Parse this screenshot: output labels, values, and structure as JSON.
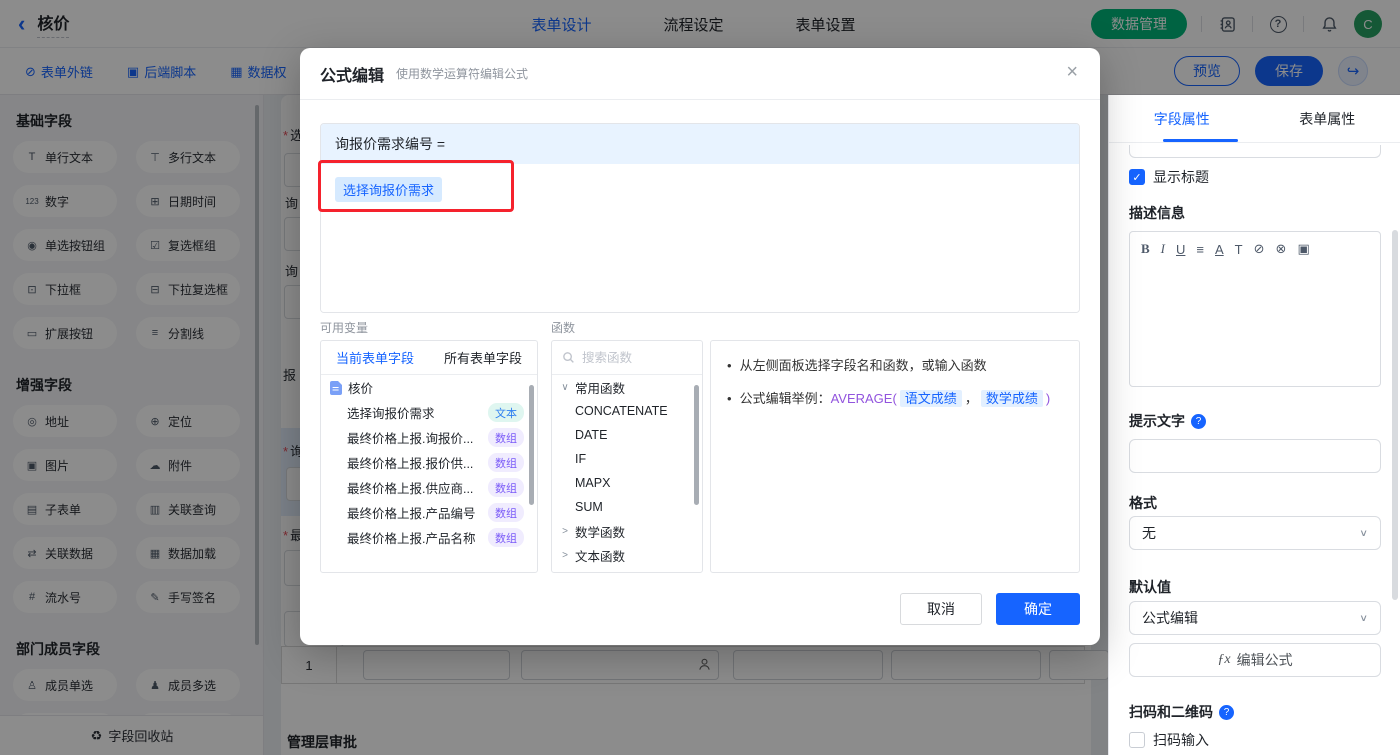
{
  "misc": {
    "asterisk": "*",
    "check": "✓",
    "chevron_down": "∨",
    "bullet": "•",
    "back": "‹",
    "close": "×",
    "share": "↪",
    "question": "?"
  },
  "topbar": {
    "title": "核价",
    "tabs": [
      {
        "label": "表单设计",
        "active": true
      },
      {
        "label": "流程设定",
        "active": false
      },
      {
        "label": "表单设置",
        "active": false
      }
    ],
    "data_manage": "数据管理",
    "avatar": "C"
  },
  "subbar": {
    "links": [
      {
        "icon": "⊘",
        "label": "表单外链"
      },
      {
        "icon": "▣",
        "label": "后端脚本"
      },
      {
        "icon": "▦",
        "label": "数据权"
      }
    ],
    "preview": "预览",
    "save": "保存"
  },
  "sidebar": {
    "sections": [
      {
        "title": "基础字段",
        "items": [
          {
            "icon": "T",
            "label": "单行文本"
          },
          {
            "icon": "⊤",
            "label": "多行文本"
          },
          {
            "icon": "123",
            "label": "数字"
          },
          {
            "icon": "⊞",
            "label": "日期时间"
          },
          {
            "icon": "◉",
            "label": "单选按钮组"
          },
          {
            "icon": "☑",
            "label": "复选框组"
          },
          {
            "icon": "⊡",
            "label": "下拉框"
          },
          {
            "icon": "⊟",
            "label": "下拉复选框"
          },
          {
            "icon": "▭",
            "label": "扩展按钮"
          },
          {
            "icon": "≡",
            "label": "分割线"
          }
        ]
      },
      {
        "title": "增强字段",
        "items": [
          {
            "icon": "◎",
            "label": "地址"
          },
          {
            "icon": "⊕",
            "label": "定位"
          },
          {
            "icon": "▣",
            "label": "图片"
          },
          {
            "icon": "☁",
            "label": "附件"
          },
          {
            "icon": "▤",
            "label": "子表单"
          },
          {
            "icon": "▥",
            "label": "关联查询"
          },
          {
            "icon": "⇄",
            "label": "关联数据"
          },
          {
            "icon": "▦",
            "label": "数据加载"
          },
          {
            "icon": "#",
            "label": "流水号"
          },
          {
            "icon": "✎",
            "label": "手写签名"
          }
        ]
      },
      {
        "title": "部门成员字段",
        "items": [
          {
            "icon": "♙",
            "label": "成员单选"
          },
          {
            "icon": "♟",
            "label": "成员多选"
          }
        ]
      }
    ],
    "recycle": {
      "icon": "♻",
      "label": "字段回收站"
    }
  },
  "canvas": {
    "fragments": [
      {
        "t": "选",
        "req": true
      },
      {
        "t": "询",
        "req": false
      },
      {
        "t": "询",
        "req": false
      },
      {
        "t": "报",
        "req": false
      },
      {
        "t": "询",
        "req": true
      },
      {
        "t": "最",
        "req": true
      }
    ],
    "row_number": "1",
    "section_title": "管理层审批"
  },
  "modal": {
    "title": "公式编辑",
    "subtitle": "使用数学运算符编辑公式",
    "formula_target": "询报价需求编号 =",
    "chip": "选择询报价需求",
    "variables": {
      "label": "可用变量",
      "tabs": [
        {
          "label": "当前表单字段",
          "active": true
        },
        {
          "label": "所有表单字段",
          "active": false
        }
      ],
      "root": "核价",
      "items": [
        {
          "name": "选择询报价需求",
          "type": "文本"
        },
        {
          "name": "最终价格上报.询报价...",
          "type": "数组"
        },
        {
          "name": "最终价格上报.报价供...",
          "type": "数组"
        },
        {
          "name": "最终价格上报.供应商...",
          "type": "数组"
        },
        {
          "name": "最终价格上报.产品编号",
          "type": "数组"
        },
        {
          "name": "最终价格上报.产品名称",
          "type": "数组"
        }
      ]
    },
    "functions": {
      "label": "函数",
      "search_placeholder": "搜索函数",
      "groups": [
        {
          "caret": "∨",
          "name": "常用函数"
        },
        {
          "caret": ">",
          "name": "数学函数"
        },
        {
          "caret": ">",
          "name": "文本函数"
        }
      ],
      "common_items": [
        "CONCATENATE",
        "DATE",
        "IF",
        "MAPX",
        "SUM"
      ]
    },
    "tips": {
      "line1": "从左侧面板选择字段名和函数，或输入函数",
      "line2_prefix": "公式编辑举例：",
      "fn": "AVERAGE(",
      "arg1": "语文成绩",
      "comma": "，",
      "arg2": "数学成绩",
      "close_paren": ")"
    },
    "cancel": "取消",
    "ok": "确定"
  },
  "panel": {
    "tabs": [
      {
        "label": "字段属性",
        "active": true
      },
      {
        "label": "表单属性",
        "active": false
      }
    ],
    "show_title": "显示标题",
    "desc_label": "描述信息",
    "toolbar": [
      {
        "name": "bold-icon",
        "glyph": "B"
      },
      {
        "name": "italic-icon",
        "glyph": "I"
      },
      {
        "name": "underline-icon",
        "glyph": "U"
      },
      {
        "name": "align-icon",
        "glyph": "≡"
      },
      {
        "name": "font-color-icon",
        "glyph": "A"
      },
      {
        "name": "font-size-icon",
        "glyph": "T"
      },
      {
        "name": "link-icon",
        "glyph": "⊘"
      },
      {
        "name": "unlink-icon",
        "glyph": "⊗"
      },
      {
        "name": "image-icon",
        "glyph": "▣"
      }
    ],
    "hint_label": "提示文字",
    "hint_value": "",
    "format_label": "格式",
    "format_value": "无",
    "default_label": "默认值",
    "default_value": "公式编辑",
    "fx_glyph": "ƒx",
    "fx_label": "编辑公式",
    "scan_label": "扫码和二维码",
    "scan_checkbox": "扫码输入"
  },
  "colors": {
    "primary": "#1664ff",
    "green": "#00b578",
    "annotation": "#f5222d",
    "badge_text_type": "#2e7ff0",
    "badge_array_type": "#7a5af8"
  }
}
